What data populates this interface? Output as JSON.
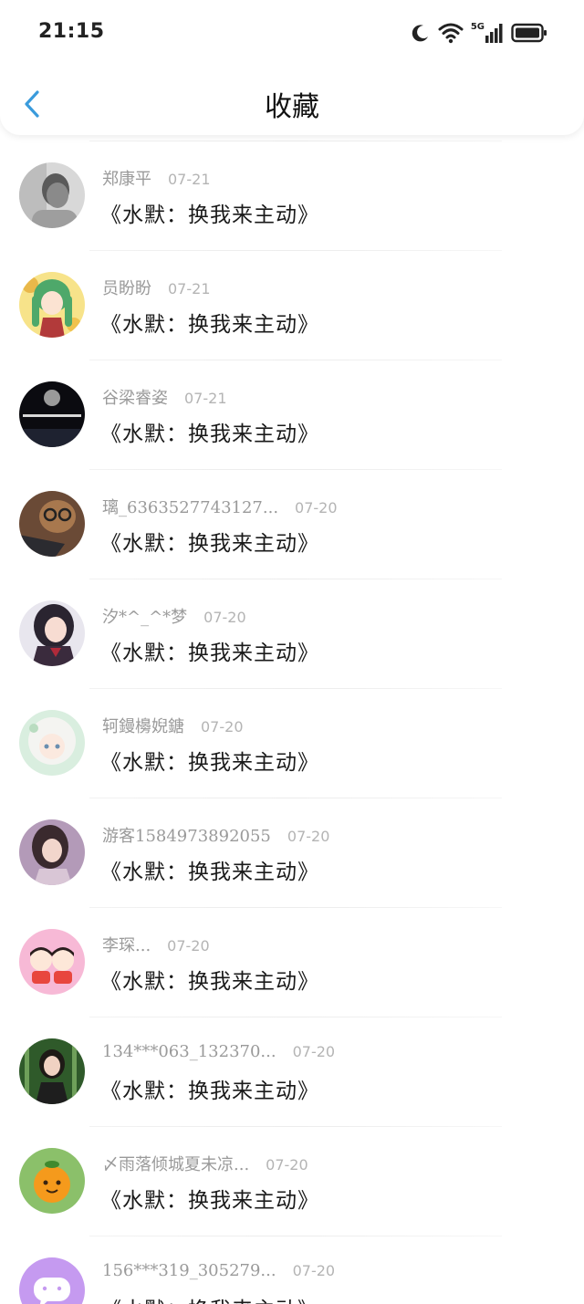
{
  "status_bar": {
    "time": "21:15",
    "network_label": "5G",
    "icons": [
      "moon-icon",
      "wifi-icon",
      "cellular-5g-icon",
      "battery-icon"
    ]
  },
  "header": {
    "title": "收藏",
    "back_icon": "chevron-left-icon",
    "accent_color": "#3a9bdc"
  },
  "favorites": [
    {
      "username": "郑康平",
      "date": "07-21",
      "work": "《水默：换我来主动》",
      "avatar": "avatar-grayscale-boy"
    },
    {
      "username": "员盼盼",
      "date": "07-21",
      "work": "《水默：换我来主动》",
      "avatar": "avatar-green-hair-anime"
    },
    {
      "username": "谷梁睿姿",
      "date": "07-21",
      "work": "《水默：换我来主动》",
      "avatar": "avatar-moon-night"
    },
    {
      "username": "璃_6363527743127...",
      "date": "07-20",
      "work": "《水默：换我来主动》",
      "avatar": "avatar-teddy-bear-laptop"
    },
    {
      "username": "汐*^_^*梦",
      "date": "07-20",
      "work": "《水默：换我来主动》",
      "avatar": "avatar-girl-uniform"
    },
    {
      "username": "轲鏝櫋婗鎕",
      "date": "07-20",
      "work": "《水默：换我来主动》",
      "avatar": "avatar-white-hair-anime"
    },
    {
      "username": "游客1584973892055",
      "date": "07-20",
      "work": "《水默：换我来主动》",
      "avatar": "avatar-woman-portrait"
    },
    {
      "username": "李琛...",
      "date": "07-20",
      "work": "《水默：换我来主动》",
      "avatar": "avatar-cartoon-couple"
    },
    {
      "username": "134***063_132370...",
      "date": "07-20",
      "work": "《水默：换我来主动》",
      "avatar": "avatar-woman-bamboo"
    },
    {
      "username": "〆雨落倾城夏未凉...",
      "date": "07-20",
      "work": "《水默：换我来主动》",
      "avatar": "avatar-orange-cartoon"
    },
    {
      "username": "156***319_305279...",
      "date": "07-20",
      "work": "《水默：换我来主动》",
      "avatar": "avatar-purple-chat-bubble"
    }
  ]
}
